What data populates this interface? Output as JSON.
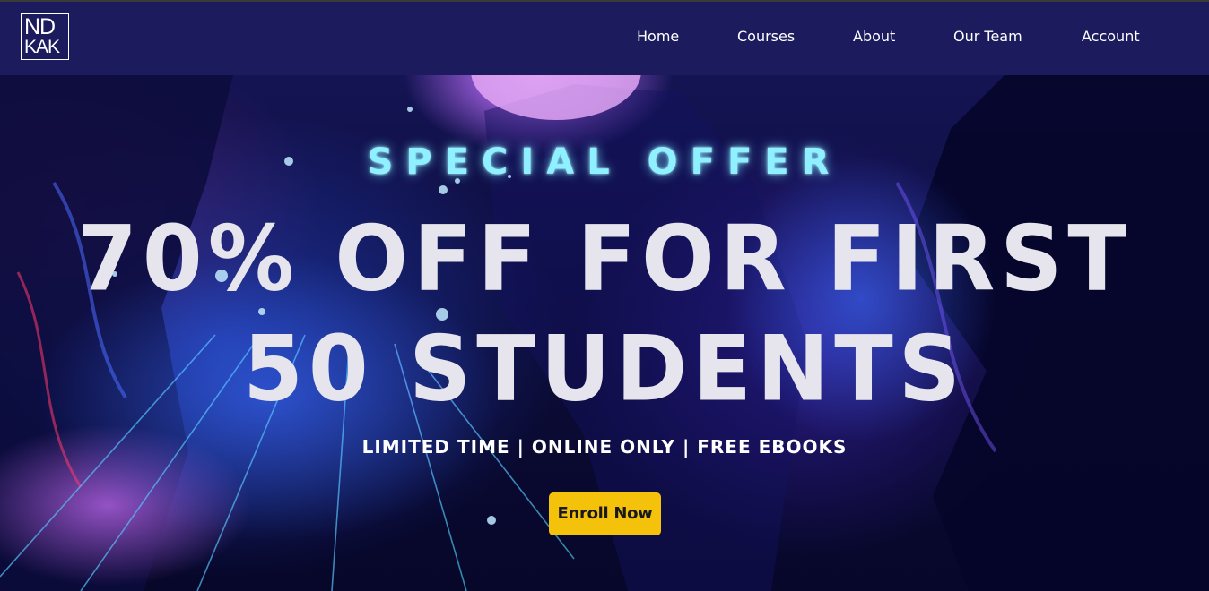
{
  "header": {
    "logo_top": "ND",
    "logo_bottom": "KAK",
    "nav": [
      "Home",
      "Courses",
      "About",
      "Our Team",
      "Account"
    ]
  },
  "hero": {
    "offer_label": "SPECIAL OFFER",
    "headline_line1": "70% OFF FOR FIRST",
    "headline_line2": "50 STUDENTS",
    "subline": "LIMITED TIME | ONLINE ONLY | FREE EBOOKS",
    "cta_label": "Enroll Now"
  },
  "colors": {
    "navbar_bg": "#1b1b5e",
    "offer_text": "#8ff0ff",
    "headline_text": "#e6e4ec",
    "cta_bg": "#f5c20b",
    "cta_text": "#1a1a1a"
  },
  "icons": {
    "logo": "ndkak-logo",
    "hero_background": "neon-grid-landscape"
  }
}
